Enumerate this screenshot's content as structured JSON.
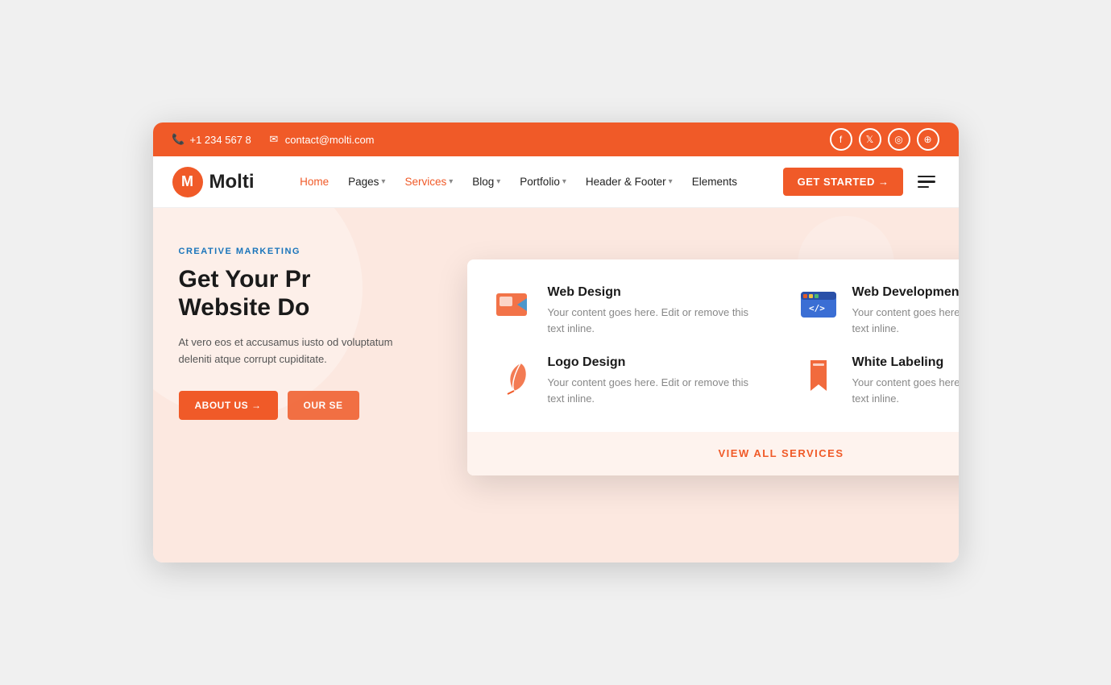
{
  "topbar": {
    "phone": "+1 234 567 8",
    "email": "contact@molti.com",
    "social": [
      "f",
      "t",
      "in",
      "dr"
    ]
  },
  "navbar": {
    "logo_initial": "M",
    "logo_text": "Molti",
    "nav_items": [
      {
        "label": "Home",
        "active": true,
        "has_dropdown": false
      },
      {
        "label": "Pages",
        "active": false,
        "has_dropdown": true
      },
      {
        "label": "Services",
        "active": false,
        "has_dropdown": true
      },
      {
        "label": "Blog",
        "active": false,
        "has_dropdown": true
      },
      {
        "label": "Portfolio",
        "active": false,
        "has_dropdown": true
      },
      {
        "label": "Header & Footer",
        "active": false,
        "has_dropdown": true
      },
      {
        "label": "Elements",
        "active": false,
        "has_dropdown": false
      }
    ],
    "cta_button": "GET STARTED →"
  },
  "hero": {
    "tag": "CREATIVE MARKETING",
    "title_line1": "Get Your Pr",
    "title_line2": "Website Do",
    "description": "At vero eos et accusamus iusto od voluptatum deleniti atque corrupt cupiditate.",
    "btn_about": "ABOUT US →",
    "btn_services": "OUR SE"
  },
  "services_dropdown": {
    "items": [
      {
        "id": "web-design",
        "title": "Web Design",
        "description": "Your content goes here. Edit or remove this text inline.",
        "icon_type": "web-design"
      },
      {
        "id": "web-development",
        "title": "Web Development",
        "description": "Your content goes here. Edit or remove this text inline.",
        "icon_type": "web-dev"
      },
      {
        "id": "logo-design",
        "title": "Logo Design",
        "description": "Your content goes here. Edit or remove this text inline.",
        "icon_type": "logo-design"
      },
      {
        "id": "white-labeling",
        "title": "White Labeling",
        "description": "Your content goes here. Edit or remove this text inline.",
        "icon_type": "white-label"
      }
    ],
    "view_all_label": "VIEW ALL SERVICES"
  }
}
